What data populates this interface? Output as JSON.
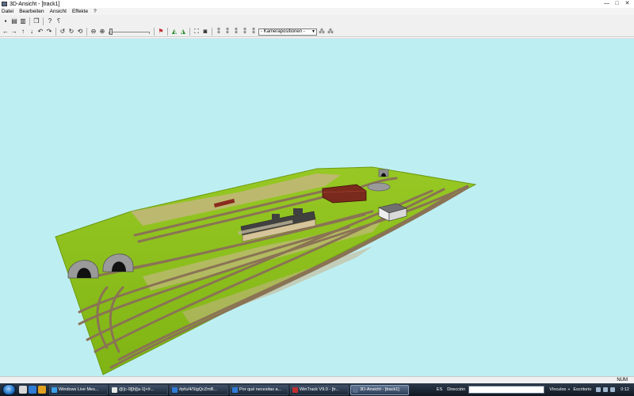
{
  "window": {
    "title": "3D-Ansicht - [track1]",
    "controls": [
      "—",
      "□",
      "✕"
    ]
  },
  "menu": [
    "Datei",
    "Bearbeiten",
    "Ansicht",
    "Effekte",
    "?"
  ],
  "toolbar": {
    "camera_select": "- Kamerapositionen -"
  },
  "statusbar": {
    "num": "NUM"
  },
  "taskbar": {
    "tasks": [
      "Windows Live Mes...",
      "@[c-9][b][a-1]<#...",
      "#pfu/4/SlgQcZmB...",
      "Por qué necesitas a...",
      "WinTrack  V9.0 - [tr...",
      "3D-Ansicht - [track1]"
    ],
    "language": "ES",
    "address_label": "Dirección",
    "links_label": "Vínculos",
    "desktop_label": "Escritorio",
    "clock": "0:12"
  },
  "colors": {
    "sky": "#bdeff2",
    "grass": "#8cc21a",
    "ballast": "#8a7355",
    "rail": "#5c4a3a",
    "roof_red": "#7a2a1c",
    "station_roof": "#404040",
    "station_wall": "#d6c49a"
  }
}
